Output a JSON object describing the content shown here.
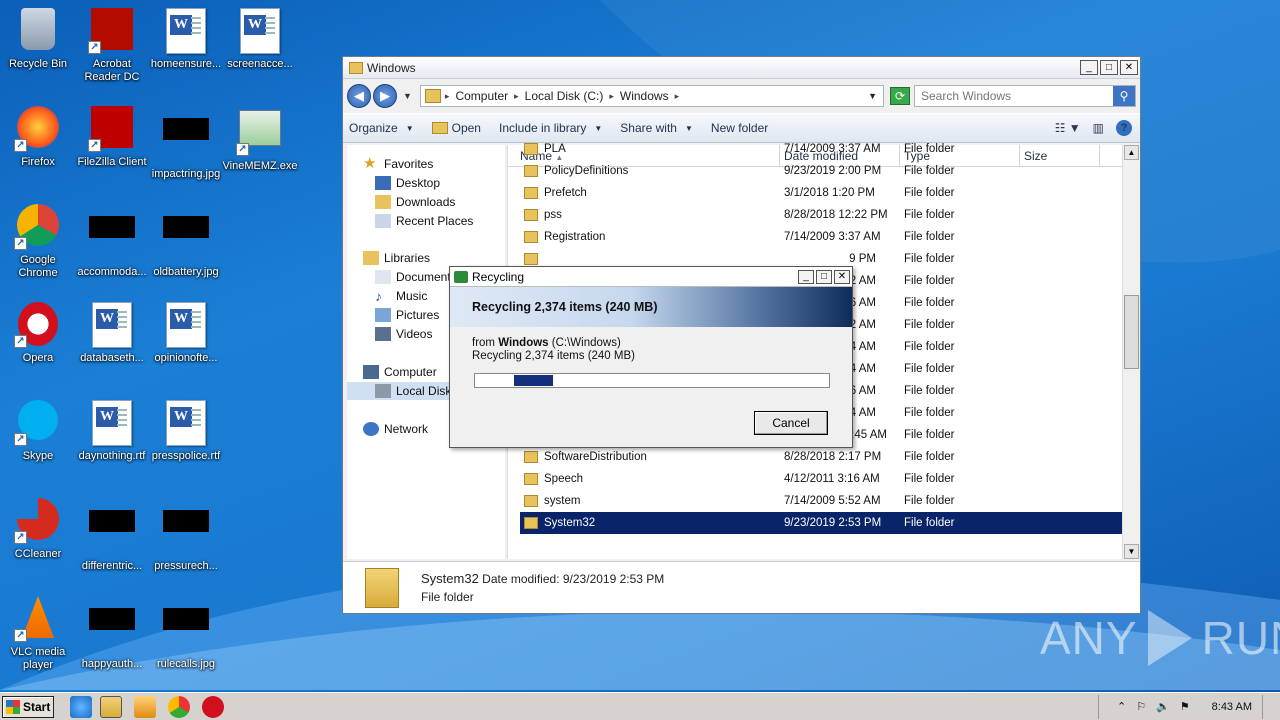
{
  "desktop": {
    "icons": [
      {
        "label": "Recycle Bin",
        "icon": "recycle-bin-icon"
      },
      {
        "label": "Acrobat Reader DC",
        "icon": "acrobat-icon"
      },
      {
        "label": "homeensure...",
        "icon": "word-doc-icon"
      },
      {
        "label": "screenacce...",
        "icon": "word-doc-icon"
      },
      {
        "label": "Firefox",
        "icon": "firefox-icon"
      },
      {
        "label": "FileZilla Client",
        "icon": "filezilla-icon"
      },
      {
        "label": "impactring.jpg",
        "icon": "image-thumb-icon"
      },
      {
        "label": "VineMEMZ.exe",
        "icon": "exe-icon"
      },
      {
        "label": "Google Chrome",
        "icon": "chrome-icon"
      },
      {
        "label": "accommoda...",
        "icon": "image-thumb-icon"
      },
      {
        "label": "oldbattery.jpg",
        "icon": "image-thumb-icon"
      },
      {
        "label": "Opera",
        "icon": "opera-icon"
      },
      {
        "label": "databaseth...",
        "icon": "word-doc-icon"
      },
      {
        "label": "opinionofte...",
        "icon": "word-doc-icon"
      },
      {
        "label": "Skype",
        "icon": "skype-icon"
      },
      {
        "label": "daynothing.rtf",
        "icon": "word-doc-icon"
      },
      {
        "label": "presspolice.rtf",
        "icon": "word-doc-icon"
      },
      {
        "label": "CCleaner",
        "icon": "ccleaner-icon"
      },
      {
        "label": "differentric...",
        "icon": "image-thumb-icon"
      },
      {
        "label": "pressurech...",
        "icon": "image-thumb-icon"
      },
      {
        "label": "VLC media player",
        "icon": "vlc-icon"
      },
      {
        "label": "happyauth...",
        "icon": "image-thumb-icon"
      },
      {
        "label": "rulecalls.jpg",
        "icon": "image-thumb-icon"
      }
    ]
  },
  "explorer": {
    "title": "Windows",
    "breadcrumb": [
      "Computer",
      "Local Disk (C:)",
      "Windows"
    ],
    "search_placeholder": "Search Windows",
    "commands": {
      "organize": "Organize",
      "open": "Open",
      "include": "Include in library",
      "share": "Share with",
      "new_folder": "New folder"
    },
    "nav": {
      "favorites": "Favorites",
      "desktop": "Desktop",
      "downloads": "Downloads",
      "recent": "Recent Places",
      "libraries": "Libraries",
      "documents": "Documents",
      "music": "Music",
      "pictures": "Pictures",
      "videos": "Videos",
      "computer": "Computer",
      "local_disk": "Local Disk (C:)",
      "network": "Network"
    },
    "columns": {
      "name": "Name",
      "date": "Date modified",
      "type": "Type",
      "size": "Size"
    },
    "rows": [
      {
        "name": "PLA",
        "date": "7/14/2009 3:37 AM",
        "type": "File folder"
      },
      {
        "name": "PolicyDefinitions",
        "date": "9/23/2019 2:00 PM",
        "type": "File folder"
      },
      {
        "name": "Prefetch",
        "date": "3/1/2018 1:20 PM",
        "type": "File folder"
      },
      {
        "name": "pss",
        "date": "8/28/2018 12:22 PM",
        "type": "File folder"
      },
      {
        "name": "Registration",
        "date": "7/14/2009 3:37 AM",
        "type": "File folder"
      },
      {
        "name": "",
        "date": "9 PM",
        "type": "File folder"
      },
      {
        "name": "",
        "date": "2 AM",
        "type": "File folder"
      },
      {
        "name": "",
        "date": "6 AM",
        "type": "File folder"
      },
      {
        "name": "",
        "date": "2 AM",
        "type": "File folder"
      },
      {
        "name": "",
        "date": "4 AM",
        "type": "File folder"
      },
      {
        "name": "",
        "date": "4 AM",
        "type": "File folder"
      },
      {
        "name": "",
        "date": "6 AM",
        "type": "File folder"
      },
      {
        "name": "",
        "date": "4 AM",
        "type": "File folder"
      },
      {
        "name": "ShellNew",
        "date": "9/23/2019 10:45 AM",
        "type": "File folder"
      },
      {
        "name": "SoftwareDistribution",
        "date": "8/28/2018 2:17 PM",
        "type": "File folder"
      },
      {
        "name": "Speech",
        "date": "4/12/2011 3:16 AM",
        "type": "File folder"
      },
      {
        "name": "system",
        "date": "7/14/2009 5:52 AM",
        "type": "File folder"
      }
    ],
    "selected_row": {
      "name": "System32",
      "date": "9/23/2019 2:53 PM",
      "type": "File folder"
    },
    "details": {
      "name": "System32",
      "date_label": "Date modified:",
      "date": "9/23/2019 2:53 PM",
      "type": "File folder"
    }
  },
  "dialog": {
    "title": "Recycling",
    "heading": "Recycling 2,374 items (240 MB)",
    "from_prefix": "from",
    "from_name": "Windows",
    "from_path": "(C:\\Windows)",
    "status": "Recycling 2,374 items (240 MB)",
    "progress_fraction": 0.11,
    "cancel": "Cancel"
  },
  "taskbar": {
    "start": "Start",
    "clock": "8:43 AM"
  },
  "watermark": {
    "left": "ANY",
    "right": "RUN"
  }
}
